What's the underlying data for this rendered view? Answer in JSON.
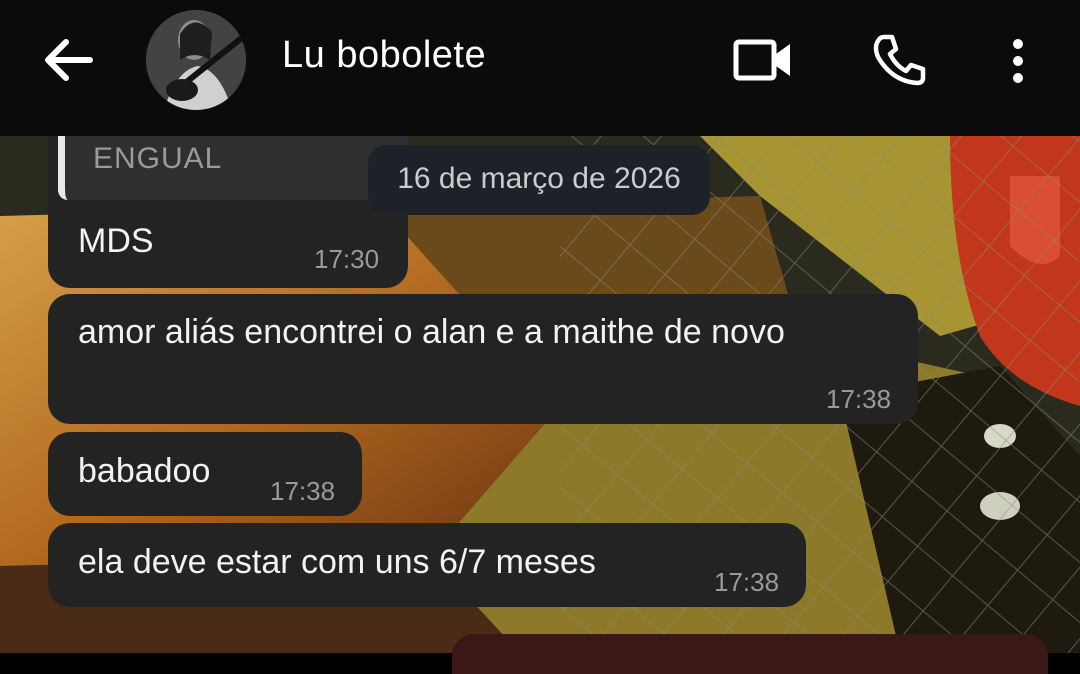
{
  "header": {
    "contact_name": "Lu bobolete",
    "back_icon": "arrow-left-icon",
    "video_icon": "video-camera-icon",
    "call_icon": "phone-icon",
    "menu_icon": "more-vertical-icon"
  },
  "chat": {
    "quoted_text": "ENGUAL",
    "date_separator": "16 de março de 2026",
    "messages": [
      {
        "text": "MDS",
        "time": "17:30"
      },
      {
        "text": "amor aliás encontrei o alan e a maithe de novo",
        "time": "17:38"
      },
      {
        "text": "babadoo",
        "time": "17:38"
      },
      {
        "text": "ela deve estar com uns 6/7 meses",
        "time": "17:38"
      }
    ]
  },
  "colors": {
    "topbar_bg": "#0b0b0b",
    "bubble_incoming": "#232323",
    "timestamp": "#9a9a9a",
    "date_pill": "#1c2227"
  }
}
